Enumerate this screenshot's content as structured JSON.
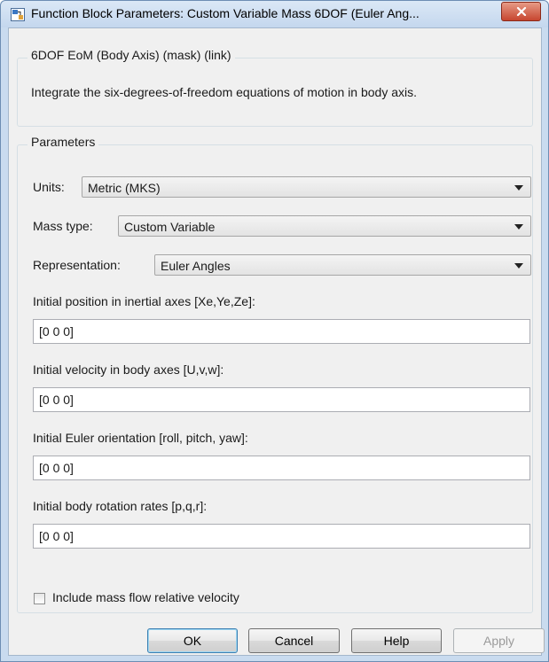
{
  "window": {
    "title": "Function Block Parameters: Custom Variable Mass 6DOF (Euler Ang...",
    "close_icon": "close-icon",
    "accent": "#c7462f"
  },
  "description": {
    "heading": "6DOF EoM (Body Axis) (mask) (link)",
    "text": "Integrate the six-degrees-of-freedom equations of motion in body axis."
  },
  "parameters": {
    "heading": "Parameters",
    "units": {
      "label": "Units:",
      "value": "Metric (MKS)"
    },
    "mass_type": {
      "label": "Mass type:",
      "value": "Custom Variable"
    },
    "representation": {
      "label": "Representation:",
      "value": "Euler Angles"
    },
    "initial_position": {
      "label": "Initial position in inertial axes [Xe,Ye,Ze]:",
      "value": "[0 0 0]"
    },
    "initial_velocity": {
      "label": "Initial velocity in body axes [U,v,w]:",
      "value": "[0 0 0]"
    },
    "initial_euler": {
      "label": "Initial Euler orientation [roll, pitch, yaw]:",
      "value": "[0 0 0]"
    },
    "initial_rates": {
      "label": "Initial body rotation rates [p,q,r]:",
      "value": "[0 0 0]"
    },
    "mass_flow_checkbox": {
      "label": "Include mass flow relative velocity",
      "checked": false
    }
  },
  "buttons": {
    "ok": "OK",
    "cancel": "Cancel",
    "help": "Help",
    "apply": "Apply"
  }
}
